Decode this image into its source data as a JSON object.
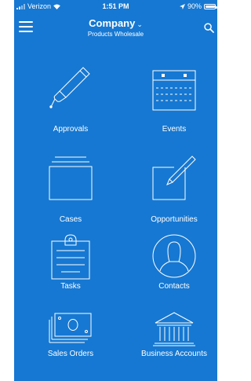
{
  "status_bar": {
    "carrier": "Verizon",
    "time": "1:51 PM",
    "battery": "90%"
  },
  "header": {
    "title": "Company",
    "subtitle": "Products Wholesale"
  },
  "tiles": [
    {
      "label": "Approvals",
      "icon": "pen-icon"
    },
    {
      "label": "Events",
      "icon": "calendar-icon"
    },
    {
      "label": "Cases",
      "icon": "folder-tray-icon"
    },
    {
      "label": "Opportunities",
      "icon": "pencil-square-icon"
    },
    {
      "label": "Tasks",
      "icon": "clipboard-icon"
    },
    {
      "label": "Contacts",
      "icon": "person-circle-icon"
    },
    {
      "label": "Sales Orders",
      "icon": "cash-stack-icon"
    },
    {
      "label": "Business Accounts",
      "icon": "bank-building-icon"
    }
  ],
  "colors": {
    "background": "#1678d2",
    "foreground": "#ffffff"
  }
}
